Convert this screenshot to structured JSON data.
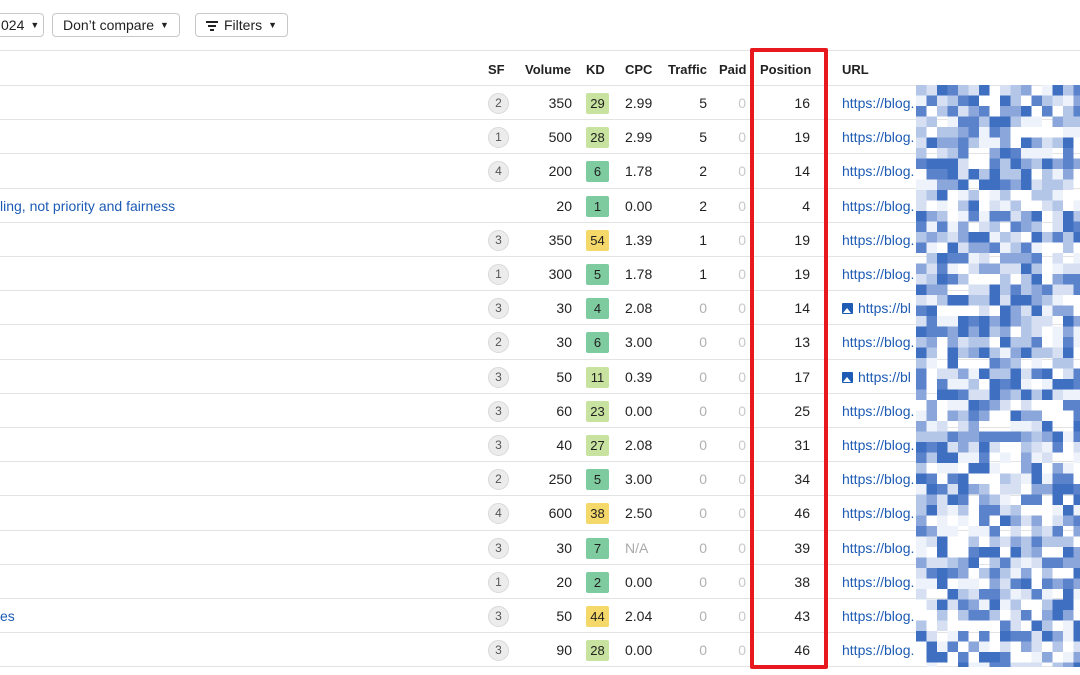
{
  "toolbar": {
    "date_fragment": "024",
    "compare_label": "Don’t compare",
    "filters_label": "Filters"
  },
  "columns": {
    "sf": "SF",
    "volume": "Volume",
    "kd": "KD",
    "cpc": "CPC",
    "traffic": "Traffic",
    "paid": "Paid",
    "position": "Position",
    "url": "URL"
  },
  "colors": {
    "link": "#1d5bb5",
    "highlight_border": "#e8191e",
    "kd_easy": "#7fcba0",
    "kd_low": "#c8e2a0",
    "kd_medium": "#f5d86a"
  },
  "rows": [
    {
      "keyword": "",
      "sf": "2",
      "volume": "350",
      "kd": "29",
      "kd_level": "low",
      "cpc": "2.99",
      "traffic": "5",
      "paid": "0",
      "position": "16",
      "url": "https://blog.",
      "url_icon": false
    },
    {
      "keyword": "",
      "sf": "1",
      "volume": "500",
      "kd": "28",
      "kd_level": "low",
      "cpc": "2.99",
      "traffic": "5",
      "paid": "0",
      "position": "19",
      "url": "https://blog.",
      "url_icon": false
    },
    {
      "keyword": "",
      "sf": "4",
      "volume": "200",
      "kd": "6",
      "kd_level": "easy",
      "cpc": "1.78",
      "traffic": "2",
      "paid": "0",
      "position": "14",
      "url": "https://blog.",
      "url_icon": false
    },
    {
      "keyword": "ling, not priority and fairness",
      "sf": "",
      "volume": "20",
      "kd": "1",
      "kd_level": "easy",
      "cpc": "0.00",
      "traffic": "2",
      "paid": "0",
      "position": "4",
      "url": "https://blog.",
      "url_icon": false
    },
    {
      "keyword": "",
      "sf": "3",
      "volume": "350",
      "kd": "54",
      "kd_level": "medium",
      "cpc": "1.39",
      "traffic": "1",
      "paid": "0",
      "position": "19",
      "url": "https://blog.",
      "url_icon": false
    },
    {
      "keyword": "",
      "sf": "1",
      "volume": "300",
      "kd": "5",
      "kd_level": "easy",
      "cpc": "1.78",
      "traffic": "1",
      "paid": "0",
      "position": "19",
      "url": "https://blog.",
      "url_icon": false
    },
    {
      "keyword": "",
      "sf": "3",
      "volume": "30",
      "kd": "4",
      "kd_level": "easy",
      "cpc": "2.08",
      "traffic": "0",
      "paid": "0",
      "position": "14",
      "url": "https://bl",
      "url_icon": true
    },
    {
      "keyword": "",
      "sf": "2",
      "volume": "30",
      "kd": "6",
      "kd_level": "easy",
      "cpc": "3.00",
      "traffic": "0",
      "paid": "0",
      "position": "13",
      "url": "https://blog.",
      "url_icon": false
    },
    {
      "keyword": "",
      "sf": "3",
      "volume": "50",
      "kd": "11",
      "kd_level": "low",
      "cpc": "0.39",
      "traffic": "0",
      "paid": "0",
      "position": "17",
      "url": "https://bl",
      "url_icon": true
    },
    {
      "keyword": "",
      "sf": "3",
      "volume": "60",
      "kd": "23",
      "kd_level": "low",
      "cpc": "0.00",
      "traffic": "0",
      "paid": "0",
      "position": "25",
      "url": "https://blog.",
      "url_icon": false
    },
    {
      "keyword": "",
      "sf": "3",
      "volume": "40",
      "kd": "27",
      "kd_level": "low",
      "cpc": "2.08",
      "traffic": "0",
      "paid": "0",
      "position": "31",
      "url": "https://blog.",
      "url_icon": false
    },
    {
      "keyword": "",
      "sf": "2",
      "volume": "250",
      "kd": "5",
      "kd_level": "easy",
      "cpc": "3.00",
      "traffic": "0",
      "paid": "0",
      "position": "34",
      "url": "https://blog.",
      "url_icon": false
    },
    {
      "keyword": "",
      "sf": "4",
      "volume": "600",
      "kd": "38",
      "kd_level": "medium",
      "cpc": "2.50",
      "traffic": "0",
      "paid": "0",
      "position": "46",
      "url": "https://blog.",
      "url_icon": false
    },
    {
      "keyword": "",
      "sf": "3",
      "volume": "30",
      "kd": "7",
      "kd_level": "easy",
      "cpc": "N/A",
      "traffic": "0",
      "paid": "0",
      "position": "39",
      "url": "https://blog.",
      "url_icon": false
    },
    {
      "keyword": "",
      "sf": "1",
      "volume": "20",
      "kd": "2",
      "kd_level": "easy",
      "cpc": "0.00",
      "traffic": "0",
      "paid": "0",
      "position": "38",
      "url": "https://blog.",
      "url_icon": false
    },
    {
      "keyword": "es",
      "sf": "3",
      "volume": "50",
      "kd": "44",
      "kd_level": "medium",
      "cpc": "2.04",
      "traffic": "0",
      "paid": "0",
      "position": "43",
      "url": "https://blog.",
      "url_icon": false
    },
    {
      "keyword": "",
      "sf": "3",
      "volume": "90",
      "kd": "28",
      "kd_level": "low",
      "cpc": "0.00",
      "traffic": "0",
      "paid": "0",
      "position": "46",
      "url": "https://blog.",
      "url_icon": false
    }
  ]
}
